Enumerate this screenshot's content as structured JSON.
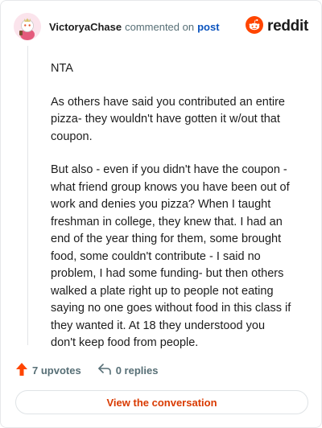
{
  "header": {
    "username": "VictoryaChase",
    "commented_on": "commented on",
    "post_link": "post",
    "brand": "reddit"
  },
  "comment": {
    "paragraphs": [
      "NTA",
      "As others have said you contributed an entire pizza- they wouldn't have gotten it w/out that coupon.",
      "But also - even if you didn't have the coupon - what friend group knows you have been out of work and denies you pizza? When I taught freshman in college, they knew that. I had an end of the year thing for them, some brought food, some couldn't contribute - I said no problem, I had some funding- but then others walked a plate right up to people not eating saying no one goes without food in this class if they wanted it. At 18 they understood you don't keep food from people."
    ]
  },
  "actions": {
    "upvotes": "7 upvotes",
    "replies": "0 replies"
  },
  "footer": {
    "view_button": "View the conversation"
  },
  "colors": {
    "brand_orange": "#ff4500",
    "link_blue": "#0a53be",
    "button_text": "#d93a00"
  },
  "icons": {
    "avatar": "snoo-avatar-icon",
    "logo": "reddit-logo-icon",
    "upvote": "upvote-arrow-icon",
    "reply": "reply-arrow-icon"
  }
}
